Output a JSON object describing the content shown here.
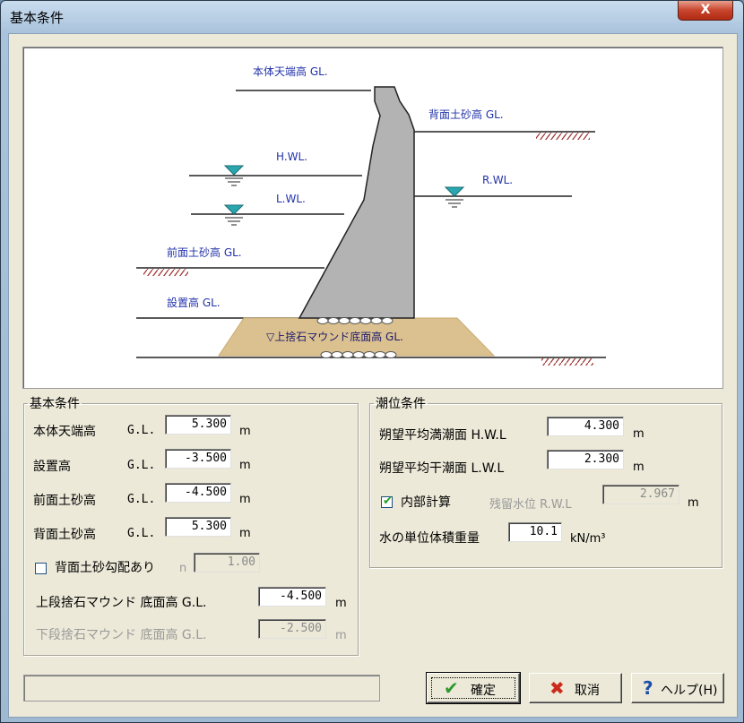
{
  "window": {
    "title": "基本条件",
    "close_label": "X"
  },
  "diagram": {
    "labels": {
      "crest": "本体天端高 GL.",
      "back_soil": "背面土砂高 GL.",
      "hwl": "H.WL.",
      "lwl": "L.WL.",
      "rwl": "R.WL.",
      "front_soil": "前面土砂高 GL.",
      "install": "設置高 GL.",
      "mound": "▽上捨石マウンド底面高 GL."
    },
    "colors": {
      "body": "#b3b3b3",
      "mound": "#dcc190",
      "label": "#2233aa",
      "water": "#2aa6ae",
      "hatch": "#9b2d2d"
    }
  },
  "basic": {
    "legend": "基本条件",
    "gl": "G.L.",
    "unit_m": "m",
    "crest_label": "本体天端高",
    "crest_value": "5.300",
    "install_label": "設置高",
    "install_value": "-3.500",
    "front_label": "前面土砂高",
    "front_value": "-4.500",
    "back_label": "背面土砂高",
    "back_value": "5.300",
    "slope_label": "背面土砂勾配あり",
    "slope_n": "n",
    "slope_value": "1.00",
    "slope_checked": false,
    "upper_label": "上段捨石マウンド 底面高 G.L.",
    "upper_value": "-4.500",
    "lower_label": "下段捨石マウンド 底面高 G.L.",
    "lower_value": "-2.500"
  },
  "tide": {
    "legend": "潮位条件",
    "hwl_label": "朔望平均満潮面 H.W.L",
    "hwl_value": "4.300",
    "lwl_label": "朔望平均干潮面 L.W.L",
    "lwl_value": "2.300",
    "internal_label": "内部計算",
    "internal_checked": true,
    "rwl_label": "残留水位 R.W.L",
    "rwl_value": "2.967",
    "unit_m": "m",
    "weight_label": "水の単位体積重量",
    "weight_value": "10.1",
    "weight_unit": "kN/m³"
  },
  "buttons": {
    "ok": "確定",
    "ok_icon": "check-icon",
    "cancel": "取消",
    "cancel_icon": "cross-icon",
    "help": "ヘルプ(H)",
    "help_icon": "question-icon"
  },
  "status_text": ""
}
